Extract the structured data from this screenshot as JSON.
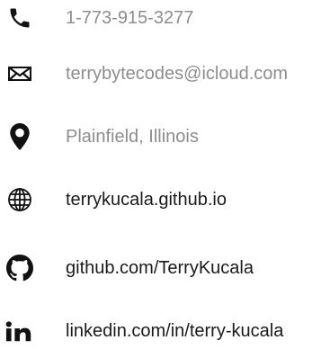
{
  "contacts": {
    "phone": {
      "text": "1-773-915-3277",
      "icon": "phone-icon"
    },
    "email": {
      "text": "terrybytecodes@icloud.com",
      "icon": "envelope-icon"
    },
    "location": {
      "text": "Plainfield, Illinois",
      "icon": "map-pin-icon"
    },
    "website": {
      "text": "terrykucala.github.io",
      "icon": "globe-icon"
    },
    "github": {
      "text": "github.com/TerryKucala",
      "icon": "github-icon"
    },
    "linkedin": {
      "text": "linkedin.com/in/terry-kucala",
      "icon": "linkedin-icon"
    }
  },
  "colors": {
    "icon": "#111111",
    "muted_text": "#8d8d8d",
    "link_text": "#1a1a1a"
  }
}
